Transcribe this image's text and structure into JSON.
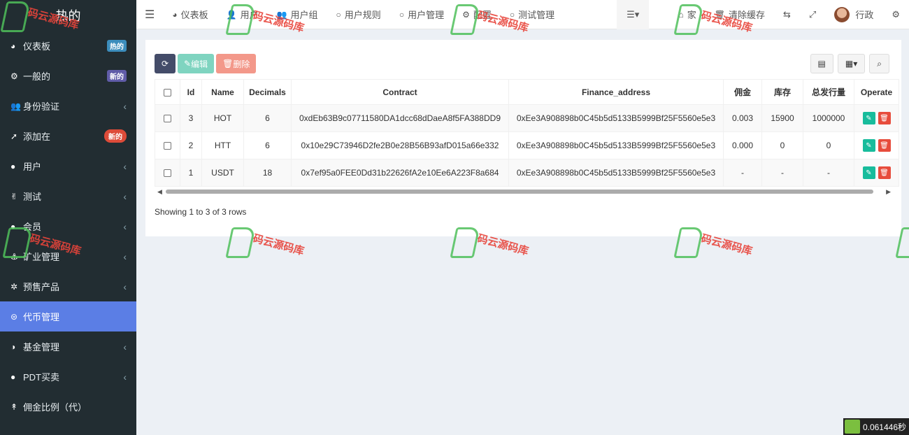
{
  "app": {
    "title": "热的"
  },
  "sidebar": {
    "items": [
      {
        "label": "仪表板",
        "icon": "dashboard-icon",
        "glyph": "◕",
        "badge": "热的",
        "badge_color": "#3c8dbc"
      },
      {
        "label": "一般的",
        "icon": "cogs-icon",
        "glyph": "⚙",
        "badge": "新的",
        "badge_color": "#605ca8"
      },
      {
        "label": "身份验证",
        "icon": "users-icon",
        "glyph": "👥",
        "chevron": "‹"
      },
      {
        "label": "添加在",
        "icon": "rocket-icon",
        "glyph": "➚",
        "badge": "新的",
        "badge_color": "#dd4b39"
      },
      {
        "label": "用户",
        "icon": "user-circle-icon",
        "glyph": "●",
        "chevron": "‹"
      },
      {
        "label": "测试",
        "icon": "test-icon",
        "glyph": "✌",
        "chevron": "‹"
      },
      {
        "label": "会员",
        "icon": "member-icon",
        "glyph": "●",
        "chevron": "‹"
      },
      {
        "label": "矿业管理",
        "icon": "anchor-icon",
        "glyph": "⚓",
        "chevron": "‹"
      },
      {
        "label": "预售产品",
        "icon": "product-icon",
        "glyph": "✲",
        "chevron": "‹"
      },
      {
        "label": "代币管理",
        "icon": "token-icon",
        "glyph": "⊜",
        "active": true
      },
      {
        "label": "基金管理",
        "icon": "fund-icon",
        "glyph": "◑",
        "chevron": "‹"
      },
      {
        "label": "PDT买卖",
        "icon": "trade-icon",
        "glyph": "●",
        "chevron": "‹"
      },
      {
        "label": "佣金比例（代）",
        "icon": "commission-icon",
        "glyph": "↟"
      }
    ]
  },
  "topbar": {
    "menu_icon": "☰",
    "items": [
      {
        "label": "仪表板",
        "icon": "dashboard-icon",
        "glyph": "◕"
      },
      {
        "label": "用户",
        "icon": "user-icon",
        "glyph": "👤"
      },
      {
        "label": "用户组",
        "icon": "users-icon",
        "glyph": "👥"
      },
      {
        "label": "用户规则",
        "icon": "circle-icon",
        "glyph": "○"
      },
      {
        "label": "用户管理",
        "icon": "circle-icon",
        "glyph": "○"
      },
      {
        "label": "配置",
        "icon": "gear-icon",
        "glyph": "⚙"
      },
      {
        "label": "测试管理",
        "icon": "circle-icon",
        "glyph": "○"
      }
    ],
    "more_icon": "☰▾",
    "right": {
      "home_label": "家",
      "clear_cache_label": "清除缓存",
      "user_name": "行政"
    }
  },
  "toolbar": {
    "edit_label": "编辑",
    "delete_label": "删除"
  },
  "table": {
    "columns": [
      "Id",
      "Name",
      "Decimals",
      "Contract",
      "Finance_address",
      "佣金",
      "库存",
      "总发行量",
      "Operate"
    ],
    "rows": [
      {
        "id": "3",
        "name": "HOT",
        "decimals": "6",
        "contract": "0xdEb63B9c07711580DA1dcc68dDaeA8f5FA388DD9",
        "finance_address": "0xEe3A908898b0C45b5d5133B5999Bf25F5560e5e3",
        "commission": "0.003",
        "stock": "15900",
        "total": "1000000"
      },
      {
        "id": "2",
        "name": "HTT",
        "decimals": "6",
        "contract": "0x10e29C73946D2fe2B0e28B56B93afD015a66e332",
        "finance_address": "0xEe3A908898b0C45b5d5133B5999Bf25F5560e5e3",
        "commission": "0.000",
        "stock": "0",
        "total": "0"
      },
      {
        "id": "1",
        "name": "USDT",
        "decimals": "18",
        "contract": "0x7ef95a0FEE0Dd31b22626fA2e10Ee6A223F8a684",
        "finance_address": "0xEe3A908898b0C45b5d5133B5999Bf25F5560e5e3",
        "commission": "-",
        "stock": "-",
        "total": "-"
      }
    ],
    "footer": "Showing 1 to 3 of 3 rows"
  },
  "timer": {
    "label": "0.061446秒"
  },
  "watermark": {
    "text": "码云源码库"
  },
  "colors": {
    "sidebar_bg": "#222d32",
    "active_bg": "#5b7ee5",
    "edit_btn": "#18bc9c",
    "delete_btn": "#e74c3c"
  }
}
